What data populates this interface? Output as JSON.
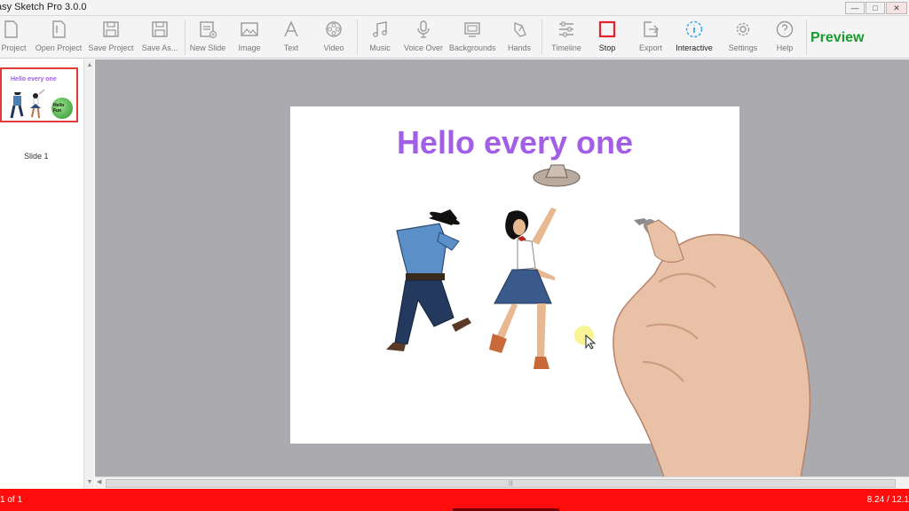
{
  "window": {
    "title": "asy Sketch Pro 3.0.0",
    "minimize": "—",
    "maximize": "□",
    "close": "✕"
  },
  "toolbar": {
    "items": [
      {
        "label": "v Project",
        "icon": "new-project-icon"
      },
      {
        "label": "Open Project",
        "icon": "open-project-icon"
      },
      {
        "label": "Save Project",
        "icon": "save-project-icon"
      },
      {
        "label": "Save As...",
        "icon": "save-as-icon"
      },
      {
        "label": "New Slide",
        "icon": "new-slide-icon"
      },
      {
        "label": "Image",
        "icon": "image-icon"
      },
      {
        "label": "Text",
        "icon": "text-icon"
      },
      {
        "label": "Video",
        "icon": "video-icon"
      },
      {
        "label": "Music",
        "icon": "music-icon"
      },
      {
        "label": "Voice Over",
        "icon": "microphone-icon"
      },
      {
        "label": "Backgrounds",
        "icon": "backgrounds-icon"
      },
      {
        "label": "Hands",
        "icon": "hand-icon"
      },
      {
        "label": "Timeline",
        "icon": "timeline-icon"
      },
      {
        "label": "Stop",
        "icon": "stop-icon"
      },
      {
        "label": "Export",
        "icon": "export-icon"
      },
      {
        "label": "Interactive",
        "icon": "interactive-icon"
      },
      {
        "label": "Settings",
        "icon": "gear-icon"
      },
      {
        "label": "Help",
        "icon": "help-icon"
      }
    ],
    "preview_label": "Preview"
  },
  "slides_panel": {
    "thumb_title": "Hello every one",
    "thumb_logo_text": "Hello Fun",
    "slide_label": "Slide 1"
  },
  "canvas": {
    "slide_title": "Hello every one"
  },
  "status": {
    "left": "1 of 1",
    "right": "8.24 / 12.1"
  },
  "colors": {
    "accent_red": "#ff0d0d",
    "title_purple": "#a25ee6",
    "preview_green": "#1a9a2e",
    "canvas_gray": "#abaaaf"
  }
}
